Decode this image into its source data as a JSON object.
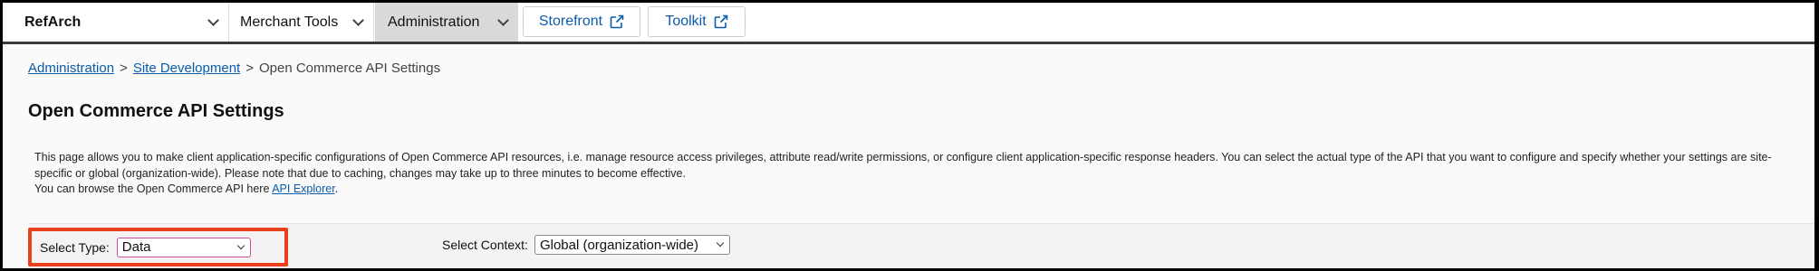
{
  "nav": {
    "site": "RefArch",
    "merchant_tools": "Merchant Tools",
    "administration": "Administration",
    "storefront": "Storefront",
    "toolkit": "Toolkit"
  },
  "breadcrumb": {
    "items": [
      "Administration",
      "Site Development",
      "Open Commerce API Settings"
    ],
    "separator": ">"
  },
  "page": {
    "title": "Open Commerce API Settings",
    "description_line1": "This page allows you to make client application-specific configurations of Open Commerce API resources, i.e. manage resource access privileges, attribute read/write permissions, or configure client application-specific response headers. You can select the actual type of the API that you want to configure and specify whether your settings are site-specific or global (organization-wide). Please note that due to caching, changes may take up to three minutes to become effective.",
    "browse_prefix": "You can browse the Open Commerce API here ",
    "browse_link": "API Explorer",
    "browse_suffix": "."
  },
  "filters": {
    "type_label": "Select Type:",
    "type_value": "Data",
    "context_label": "Select Context:",
    "context_value": "Global (organization-wide)"
  },
  "colors": {
    "highlight": "#e8401c",
    "link": "#0b5cab",
    "active_nav": "#d9d9d9"
  },
  "icons": {
    "dropdown": "chevron-down-icon",
    "external": "external-link-icon"
  }
}
